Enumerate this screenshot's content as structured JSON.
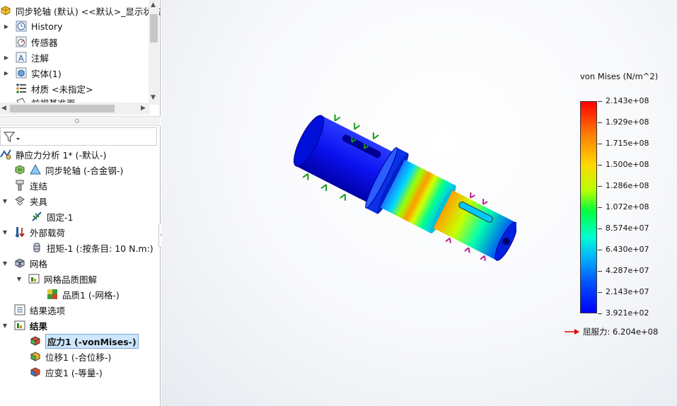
{
  "feature_tree": {
    "part_name": "同步轮轴 (默认) <<默认>_显示状态",
    "items": [
      {
        "label": "History",
        "icon": "history-icon"
      },
      {
        "label": "传感器",
        "icon": "sensor-icon"
      },
      {
        "label": "注解",
        "icon": "annotation-icon"
      },
      {
        "label": "实体(1)",
        "icon": "solid-body-icon"
      },
      {
        "label": "材质 <未指定>",
        "icon": "material-icon"
      },
      {
        "label": "前视基准面",
        "icon": "plane-icon"
      }
    ]
  },
  "study_tree": {
    "study": "静应力分析 1* (-默认-)",
    "part": "同步轮轴 (-合金钢-)",
    "connections": "连结",
    "fixtures": "夹具",
    "fixed": "固定-1",
    "external_loads": "外部载荷",
    "torque": "扭矩-1 (:按条目: 10 N.m:)",
    "mesh": "网格",
    "mesh_quality_plot": "网格品质图解",
    "quality": "品质1 (-网格-)",
    "result_options": "结果选项",
    "results": "结果",
    "stress": "应力1 (-vonMises-)",
    "displacement": "位移1 (-合位移-)",
    "strain": "应变1 (-等量-)"
  },
  "legend": {
    "title": "von Mises (N/m^2)",
    "ticks": [
      "2.143e+08",
      "1.929e+08",
      "1.715e+08",
      "1.500e+08",
      "1.286e+08",
      "1.072e+08",
      "8.574e+07",
      "6.430e+07",
      "4.287e+07",
      "2.143e+07",
      "3.921e+02"
    ],
    "yield_label": "屈服力: 6.204e+08",
    "colors": {
      "max": "#ff0000",
      "min": "#0000ff"
    }
  }
}
